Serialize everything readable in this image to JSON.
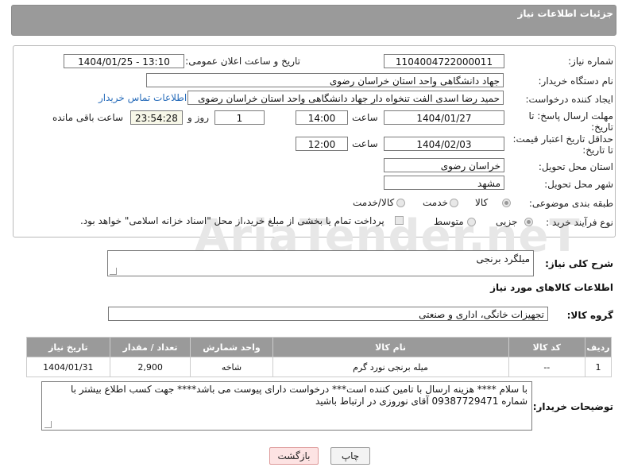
{
  "header": {
    "title": "جزئیات اطلاعات نیاز"
  },
  "form": {
    "need_number_label": "شماره نیاز:",
    "need_number": "1104004722000011",
    "announce_label": "تاریخ و ساعت اعلان عمومی:",
    "announce_value": "1404/01/25 - 13:10",
    "buyer_org_label": "نام دستگاه خریدار:",
    "buyer_org": "جهاد دانشگاهی واحد استان خراسان رضوی",
    "requester_label": "ایجاد کننده درخواست:",
    "requester": "حمید رضا اسدی الفت تنخواه دار جهاد دانشگاهی واحد استان خراسان رضوی",
    "contact_link": "اطلاعات تماس خریدار",
    "deadline_label_1": "مهلت ارسال پاسخ: تا",
    "deadline_label_2": "تاریخ:",
    "deadline_date": "1404/01/27",
    "time_label": "ساعت",
    "deadline_time": "14:00",
    "days_value": "1",
    "days_label": "روز و",
    "remaining_time": "23:54:28",
    "remaining_label": "ساعت باقی مانده",
    "validity_label_1": "حداقل تاریخ اعتبار قیمت:",
    "validity_label_2": "تا تاریخ:",
    "validity_date": "1404/02/03",
    "validity_time_label": "ساعت",
    "validity_time": "12:00",
    "province_label": "استان محل تحویل:",
    "province": "خراسان رضوی",
    "city_label": "شهر محل تحویل:",
    "city": "مشهد",
    "category_label": "طبقه بندی موضوعی:",
    "category_options": [
      "کالا",
      "خدمت",
      "کالا/خدمت"
    ],
    "category_selected": "کالا",
    "process_label": "نوع فرآیند خرید :",
    "process_options": [
      "جزیی",
      "متوسط"
    ],
    "payment_note": "پرداخت تمام یا بخشی از مبلغ خرید،از محل \"اسناد خزانه اسلامی\" خواهد بود."
  },
  "description": {
    "label": "شرح کلی نیاز:",
    "value": "میلگرد برنجی"
  },
  "goods": {
    "section_title": "اطلاعات کالاهای مورد نیاز",
    "group_label": "گروه کالا:",
    "group_value": "تجهیزات خانگی، اداری و صنعتی",
    "columns": [
      "ردیف",
      "کد کالا",
      "نام کالا",
      "واحد شمارش",
      "تعداد / مقدار",
      "تاریخ نیاز"
    ],
    "rows": [
      [
        "1",
        "--",
        "میله برنجی نورد گرم",
        "شاخه",
        "2,900",
        "1404/01/31"
      ]
    ]
  },
  "notes": {
    "label": "توضیحات خریدار:",
    "value": "با سلام **** هزینه ارسال با تامین کننده است*** درخواست دارای پیوست می باشد**** جهت کسب اطلاع بیشتر با شماره 09387729471 آقای نوروزی در ارتباط باشید"
  },
  "buttons": {
    "print": "چاپ",
    "back": "بازگشت"
  },
  "watermark": "AriaTender.neT"
}
